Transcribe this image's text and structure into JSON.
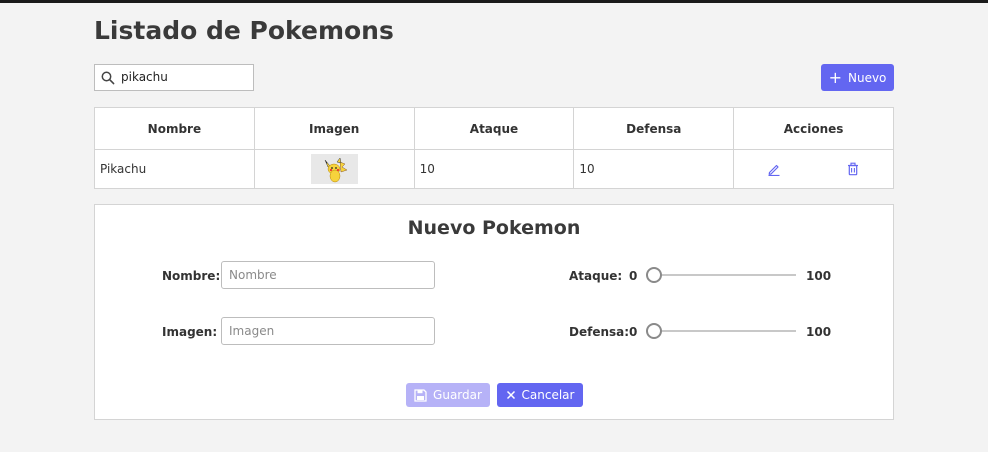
{
  "header": {
    "title": "Listado de Pokemons"
  },
  "search": {
    "value": "pikachu",
    "icon": "search-icon"
  },
  "toolbar": {
    "new_label": "Nuevo",
    "new_icon": "plus-icon",
    "accent_color": "#6366f1"
  },
  "table": {
    "columns": [
      "Nombre",
      "Imagen",
      "Ataque",
      "Defensa",
      "Acciones"
    ],
    "rows": [
      {
        "nombre": "Pikachu",
        "imagen": "pikachu-image",
        "ataque": "10",
        "defensa": "10",
        "actions": [
          "edit-icon",
          "trash-icon"
        ]
      }
    ]
  },
  "form": {
    "title": "Nuevo Pokemon",
    "nombre_label": "Nombre:",
    "nombre_placeholder": "Nombre",
    "imagen_label": "Imagen:",
    "imagen_placeholder": "Imagen",
    "ataque_label": "Ataque:",
    "ataque": {
      "min": "0",
      "max": "100",
      "value": 0
    },
    "defensa_label": "Defensa:",
    "defensa": {
      "min": "0",
      "max": "100",
      "value": 0
    },
    "save_label": "Guardar",
    "save_enabled": false,
    "cancel_label": "Cancelar"
  }
}
